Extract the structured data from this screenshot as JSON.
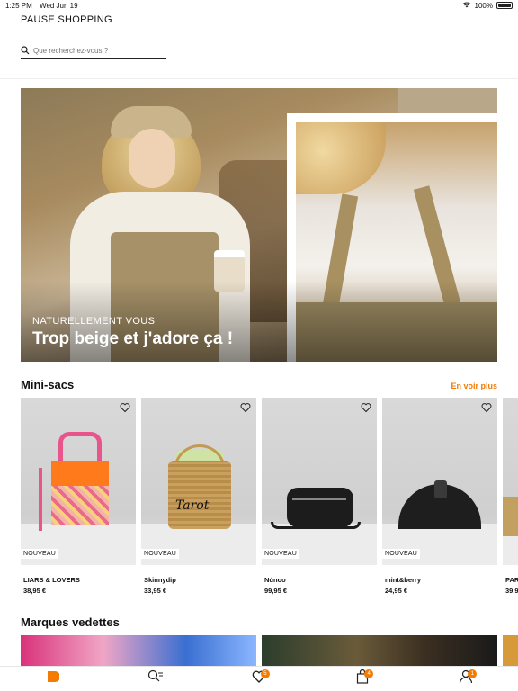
{
  "status_bar": {
    "time": "1:25 PM",
    "date": "Wed Jun 19",
    "battery": "100%"
  },
  "header": {
    "title": "PAUSE SHOPPING",
    "search_placeholder": "Que recherchez-vous ?"
  },
  "hero": {
    "kicker": "NATURELLEMENT VOUS",
    "title": "Trop beige et j'adore ça !"
  },
  "mini_sacs": {
    "title": "Mini-sacs",
    "see_more": "En voir plus",
    "products": [
      {
        "badge": "NOUVEAU",
        "brand": "LIARS & LOVERS",
        "price": "38,95 €"
      },
      {
        "badge": "NOUVEAU",
        "brand": "Skinnydip",
        "price": "33,95 €"
      },
      {
        "badge": "NOUVEAU",
        "brand": "Núnoo",
        "price": "99,95 €"
      },
      {
        "badge": "NOUVEAU",
        "brand": "mint&berry",
        "price": "24,95 €"
      },
      {
        "badge": "",
        "brand": "PAR",
        "price": "39,9"
      }
    ]
  },
  "featured_brands": {
    "title": "Marques vedettes"
  },
  "bag_print": "Tarot",
  "tabbar": {
    "favorites_count": "5",
    "cart_count": "4",
    "profile_count": "1"
  },
  "colors": {
    "accent": "#f47a00"
  }
}
